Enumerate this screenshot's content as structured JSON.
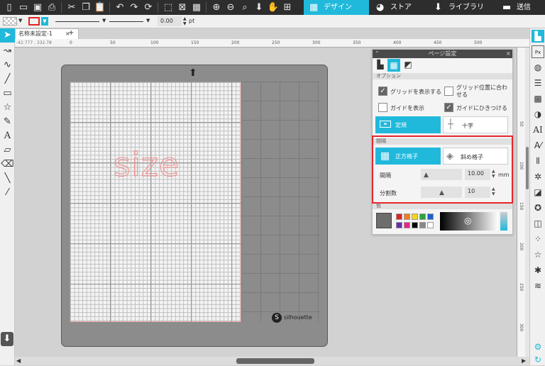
{
  "top_nav": {
    "design": "デザイン",
    "store": "ストア",
    "library": "ライブラリ",
    "send": "送信"
  },
  "prop_bar": {
    "stroke_width": "0.00",
    "unit": "pt"
  },
  "doc_tab": {
    "title": "名称未設定-1",
    "close": "×",
    "add": "+"
  },
  "ruler": {
    "coords": "-42.777 , 332.78",
    "ticks": [
      "0",
      "50",
      "100",
      "150",
      "200",
      "250",
      "300",
      "350",
      "400",
      "450",
      "500"
    ]
  },
  "vruler": {
    "ticks": [
      "50",
      "100",
      "150",
      "200",
      "250",
      "300"
    ]
  },
  "canvas": {
    "sample_text": "size",
    "brand": "silhouette"
  },
  "panel": {
    "title": "ページ設定",
    "options_header": "オプション",
    "show_grid": "グリッドを表示する",
    "snap_grid": "グリッド位置に合わせる",
    "show_guides": "ガイドを表示",
    "snap_guides": "ガイドにひきつける",
    "ruler_btn": "定規",
    "cross_btn": "十字",
    "spacing_header": "間隔",
    "square_grid": "正方格子",
    "diagonal_grid": "斜め格子",
    "interval_label": "間隔",
    "interval_value": "10.00",
    "interval_unit": "mm",
    "divisions_label": "分割数",
    "divisions_value": "10",
    "color_header": "色"
  },
  "colors": {
    "accent": "#20b9dc",
    "highlight": "#e3262c"
  },
  "swatches": [
    "#e02424",
    "#f07d1e",
    "#f2d61b",
    "#2aa53a",
    "#1f5fd0",
    "#6b2ca8",
    "#e8258c",
    "#000000",
    "#888888",
    "#ffffff"
  ]
}
